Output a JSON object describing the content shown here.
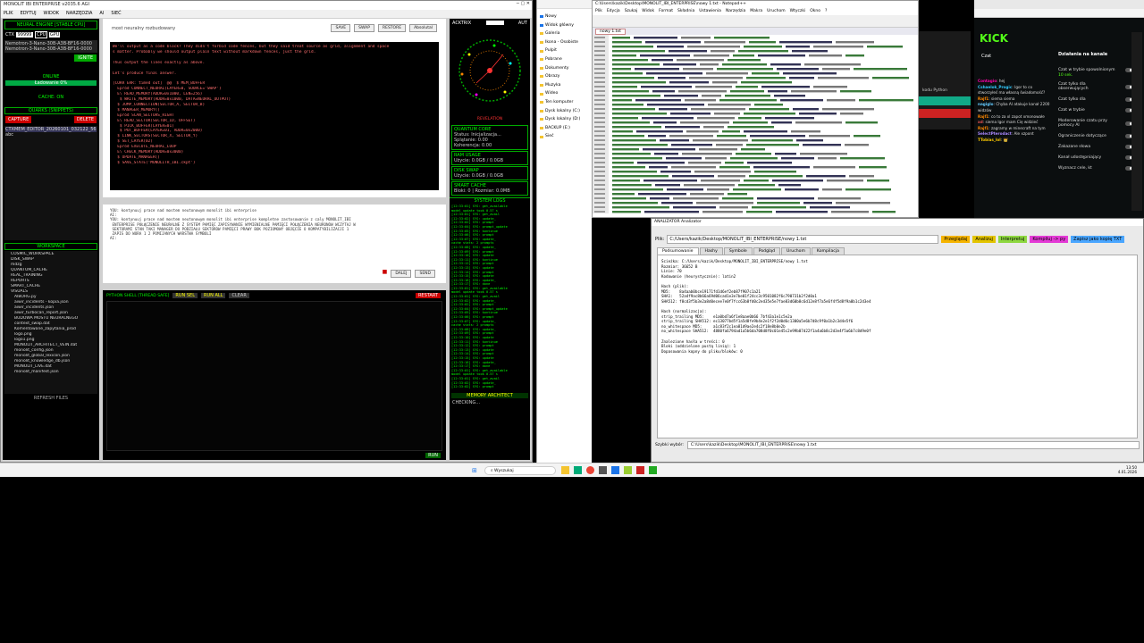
{
  "monolit": {
    "title": "MONOLIT IBI ENTERPRISE v2035.6 AGI",
    "menu": [
      "PLIK",
      "EDYTUJ",
      "WIDOK",
      "NARZĘDZIA",
      "AI",
      "SIEĆ"
    ],
    "left": {
      "engine": "NEURAL ENGINE [STABLE CPU]",
      "ctx_label": "CTX",
      "ctx_value": "99999",
      "cpu_label": "CPU",
      "gpu_label": "GPU",
      "models": [
        "Nemotron-3-Nano-30B-A3B-BF16-0000",
        "Nemotron-3-Nano-30B-A3B-BF16-0000"
      ],
      "ignite": "IGNITE",
      "online": "ONLINE",
      "loading": "Ładowanie 0%",
      "cache": "CACHE: ON",
      "quarks": "QUARKS (SNIPPETS)",
      "capture": "CAPTURE",
      "delete": "DELETE",
      "snippet": "CTXMEM_EDITOR_20260101_032122_566",
      "snippet_sub": "abc",
      "workspace": "WORKSPACE",
      "tree": [
        "COSMIC_WORKSPACE",
        "DISK_SWAP",
        "mdzg",
        "QUANTUM_CACHE",
        "REAL_TRAINING",
        "REPORTS",
        "SMART_CACHE",
        "VISUALS",
        "AIBORG.py",
        "aiwir_incidents - kopia.json",
        "aiwir_incidents.json",
        "aiwir_turbocan_report.json",
        "BUDOWA MOSTU NEURALNEGO",
        "context_swap.dat",
        "Komentowane_zapytania_prod",
        "logo.png",
        "logo1.png",
        "MONOLIT_ARCHITECT_VEIN.dat",
        "monolit_config.json",
        "monolit_global_lexicon.json",
        "monolit_knowledge_db.json",
        "MONOLIT_LIVE.dat",
        "monolit_manifest.json"
      ],
      "refresh": "REFRESH FILES"
    },
    "chat": {
      "header": "most neuralny rozbudowany",
      "buttons": [
        "SAVE",
        "SWAP",
        "RESTORE",
        "Absolutal"
      ],
      "lines": [
        "We'll output as a code block? They didn't forbid code fences, but they said treat source as grid, alignment and space",
        "s matter. Probably we should output plain text without markdown fences, just the grid.",
        "",
        "Thus output the lines exactly as above.",
        "",
        "Let's produce final answer.",
        "",
        "[CORR ERR: timed out]  @@  $ MEM_BUFFER",
        "  Epród CONNECT_NEURAL(LAYER=0, SOURCE='SWAP')",
        "  E\\ READ_MEMORY(ADDR=0x1000, LEN=256)",
        "   $ WRITE_MEMORY(ADDR=0x1000, DATA=NEURAL_OUTPUT)",
        "  $ JUMP_CONNECTION(SECTOR_A, SECTOR_B)",
        "  $ MANAGER_MEMORY()",
        "  Epród SCAN_SECTORS_RIGHT",
        "  E\\ READ_SECTOR(SECTOR_ID, OFFSET)",
        "   $ PICK_BUFFER(LAYER=01)",
        "   $ PUT_BUFFER(LAYER=01, ADDR=0x2000)",
        "  $ LINK_SECTORS(SECTOR_X, SECTOR_Y)",
        "  $ SET_LAYER(02)",
        "  Epród EXECUTE_NEURAL_LOOP",
        "  E\\ CHECK_MEMORY(ADDR=0x3000)",
        "  $ UPDATE_MANAGER()",
        "  $ SAVE_STATE('MONOLITH_IBI.ckpt')"
      ]
    },
    "input": {
      "lines": [
        "YOU: kontynuuj prace nad mostem neutonowym monolit ibi enterprise",
        "AI:",
        "YOU: kontynuuj prace nad mostem neutonowym monolit ibi enterprise kompletne zastosowanie z caly MONOLIT_IBI",
        " ENTERPRISE POŁĄCZENIE NEURALNE Z SYSTEM PAMIĘĆ ZAPISYWANIE WYMIENIALNE PAMIĘCI POŁĄCZENIA NEURONÓW WCZYTAJ W",
        " SEKTORAMI STAN TAKI MANAGER DO PODZIAŁU SEKTORÓW PAMIĘCI PRAWY BOK POZIOMOWY OBJĘCIE O KOMPATYBILIZACJI 1",
        " ZAPIS DO WORA 1 2 POMIJANYCH WARSTWA SYMBOLI",
        "AI:"
      ],
      "send": "SEND",
      "extra": "DALEJ"
    },
    "shell": {
      "title": "PYTHON SHELL [THREAD SAFE]",
      "buttons": [
        "RUN SEL",
        "RUN ALL",
        "CLEAR"
      ],
      "restart": "RESTART",
      "run": "RUN"
    },
    "monitor": {
      "title": "ACKTRIX",
      "auto": "AUT",
      "revelation": "REVELATION",
      "quantum": "QUANTUM CORE",
      "status": "Status: Inicjalizacja...",
      "splatanie": "Splątanie: 0.00",
      "koherencja": "Koherencja: 0.00",
      "ram": "RAM USAGE",
      "ram_used": "Użycie: 0.0GB / 0.0GB",
      "disk": "DISK SWAP",
      "disk_used": "Użycie: 0.0GB / 0.0GB",
      "smart": "SMART CACHE",
      "smart_info": "Bloki: 0 | Rozmiar: 0.0MB",
      "syslogs": "SYSTEM LOGS",
      "log_lines": [
        "[12:33:01] SYS: get_available",
        "model update took 0.57 s",
        "[12:33:01] SYS: get_avail",
        "[12:33:02] SYS: update_",
        "[12:33:02] SYS: prompt",
        "[12:33:04] SYS: prompt_update",
        "[12:33:05] SYS: kontinue",
        "[12:33:06] SYS: prompt",
        "[12:33:07] SYS: update_",
        "cache stats: 2 prompts",
        "[12:33:08] SYS: update_",
        "[12:33:09] SYS: prompt",
        "[12:33:10] SYS: update",
        "[12:33:11] SYS: kontinue",
        "[12:33:12] SYS: prompt",
        "[12:33:13] SYS: update",
        "[12:33:14] SYS: prompt",
        "[12:33:15] SYS: update",
        "[12:33:16] SYS: update_",
        "[12:33:17] SYS: done"
      ],
      "architect": "MEMORY ARCHITECT",
      "checking": "CHECKING..."
    }
  },
  "explorer": {
    "items": [
      "Nowy",
      "Widok główny",
      "Galeria",
      "Ikona - Osobiste",
      "Pulpit",
      "Pobrane",
      "Dokumenty",
      "Obrazy",
      "Muzyka",
      "Wideo",
      "Ten komputer",
      "Dysk lokalny (C:)",
      "Dysk lokalny (D:)",
      "BACKUP (E:)",
      "Sieć"
    ]
  },
  "npp": {
    "title": "C:\\Users\\kazik\\Desktop\\MONOLIT_IBI_ENTERPRISE\\nowy 1.txt - Notepad++",
    "menu": [
      "Plik",
      "Edycja",
      "Szukaj",
      "Widok",
      "Format",
      "Składnia",
      "Ustawienia",
      "Narzędzia",
      "Makra",
      "Uruchom",
      "Wtyczki",
      "Okno",
      "?"
    ],
    "tab": "nowy 1.txt"
  },
  "kick": {
    "logo": "KICK",
    "chat_title": "Czat",
    "panel_title": "Działania na kanale",
    "messages": [
      {
        "user": "Contagio",
        "text": "hej"
      },
      {
        "user": "Cshaelok_Progic",
        "text": "Igor to co stworzyłeś ma własną świadomość?"
      },
      {
        "user": "Rajf1",
        "text": "siema siema"
      },
      {
        "user": "nagiglo",
        "text": "Chyba AI atakuje kanał 2200 widzów"
      },
      {
        "user": "Rajf1",
        "text": "co to za xl zapot xmonowałe"
      },
      {
        "user": "xd",
        "text": "siema Igor mam Cię widzieć"
      },
      {
        "user": "Rajf1",
        "text": "zagramy w minecraft na tym"
      },
      {
        "user": "SelectPterodact",
        "text": "Ale xzpont"
      },
      {
        "user": "TTobias_lol",
        "text": "👑"
      }
    ],
    "settings": [
      "Czat w trybie spowolnionym",
      "Czat tylko dla obserwujących",
      "Czat tylko dla",
      "Czat w trybie",
      "Moderowanie czatu przy pomocy AI",
      "Ograniczenie dotyczące",
      "Zakazane słowa",
      "Kanał udostępniający",
      "Wyznacz cele, kt"
    ],
    "settings_sub": "10 sek."
  },
  "darkwin": {
    "label": "kodu Python"
  },
  "analyzer": {
    "title": "ANALIZATOR Analizator",
    "path_label": "Plik:",
    "path": "C:/Users/kazik/Desktop/MONOLIT_IBI_ENTERPRISE/nowy 1.txt",
    "buttons": [
      "Przeglądaj",
      "Analizuj",
      "Interpretuj",
      "Kompiluj -> py",
      "Zapisz jako kopię TXT"
    ],
    "tabs": [
      "Podsumowanie",
      "Hashy",
      "Symbole",
      "Podgląd",
      "Uruchom",
      "Kompilacja"
    ],
    "lines": [
      "Ścieżka: C:/Users/kazik/Desktop/MONOLIT_IBI_ENTERPRISE/nowy 1.txt",
      "Rozmiar: 36652 B",
      "Linie: 70",
      "Kodowanie (heurystycznie): latin2",
      "",
      "Hash (plik):",
      "MD5:    8a4aab0bce19171fd1d6ef2eb87f907c1a21",
      "SHA1:   52a4f9ac8b66a69d06cad1e3e7be01f24cc3c9501082f6c790731b2f2d0a1",
      "SHA512: f8cd3f5b3e2a8d0ecee7e0f7fcc63b8fd0c2ed35e5e7fae83d60b8c6d12e8f7a5e6f4f5d8f9a0b1c2d3e4",
      "",
      "Hash (normalizacja):",
      "strip_trailing MD5:    e1a0bd7a6f1e8aae0b66 7bf43a1e1c5e2a",
      "strip_trailing SHA512: ec13077bd5f1a5d8fe9b4e2e1f2f2d0d6c1300a5e6b7d8c9f0a1b2c3d4e5f6",
      "no_whitespace MD5:     a1c83f2c1ea81d9ae2e4c2f18e8b0e2b",
      "no_whitespace SHA512:  4880fa6794ad1a5b6da708d8f0c01e45c2e99b07d22f1a4a6b8c2d3e4f5a6b7c8d9e0f",
      "",
      "Znalezione hasła w treści: 0",
      "Bloki (oddzielone pustą linią): 1",
      "Dopasowania kopny do pliku/bloków: 0"
    ],
    "bottom_label": "Szybki wybór:",
    "bottom_value": "C:\\Users\\kazik\\Desktop\\MONOLIT_IBI_ENTERPRISE\\nowy 1.txt"
  },
  "taskbar": {
    "search": "Wyszukaj",
    "time": "13:50",
    "date": "4.01.2026"
  }
}
